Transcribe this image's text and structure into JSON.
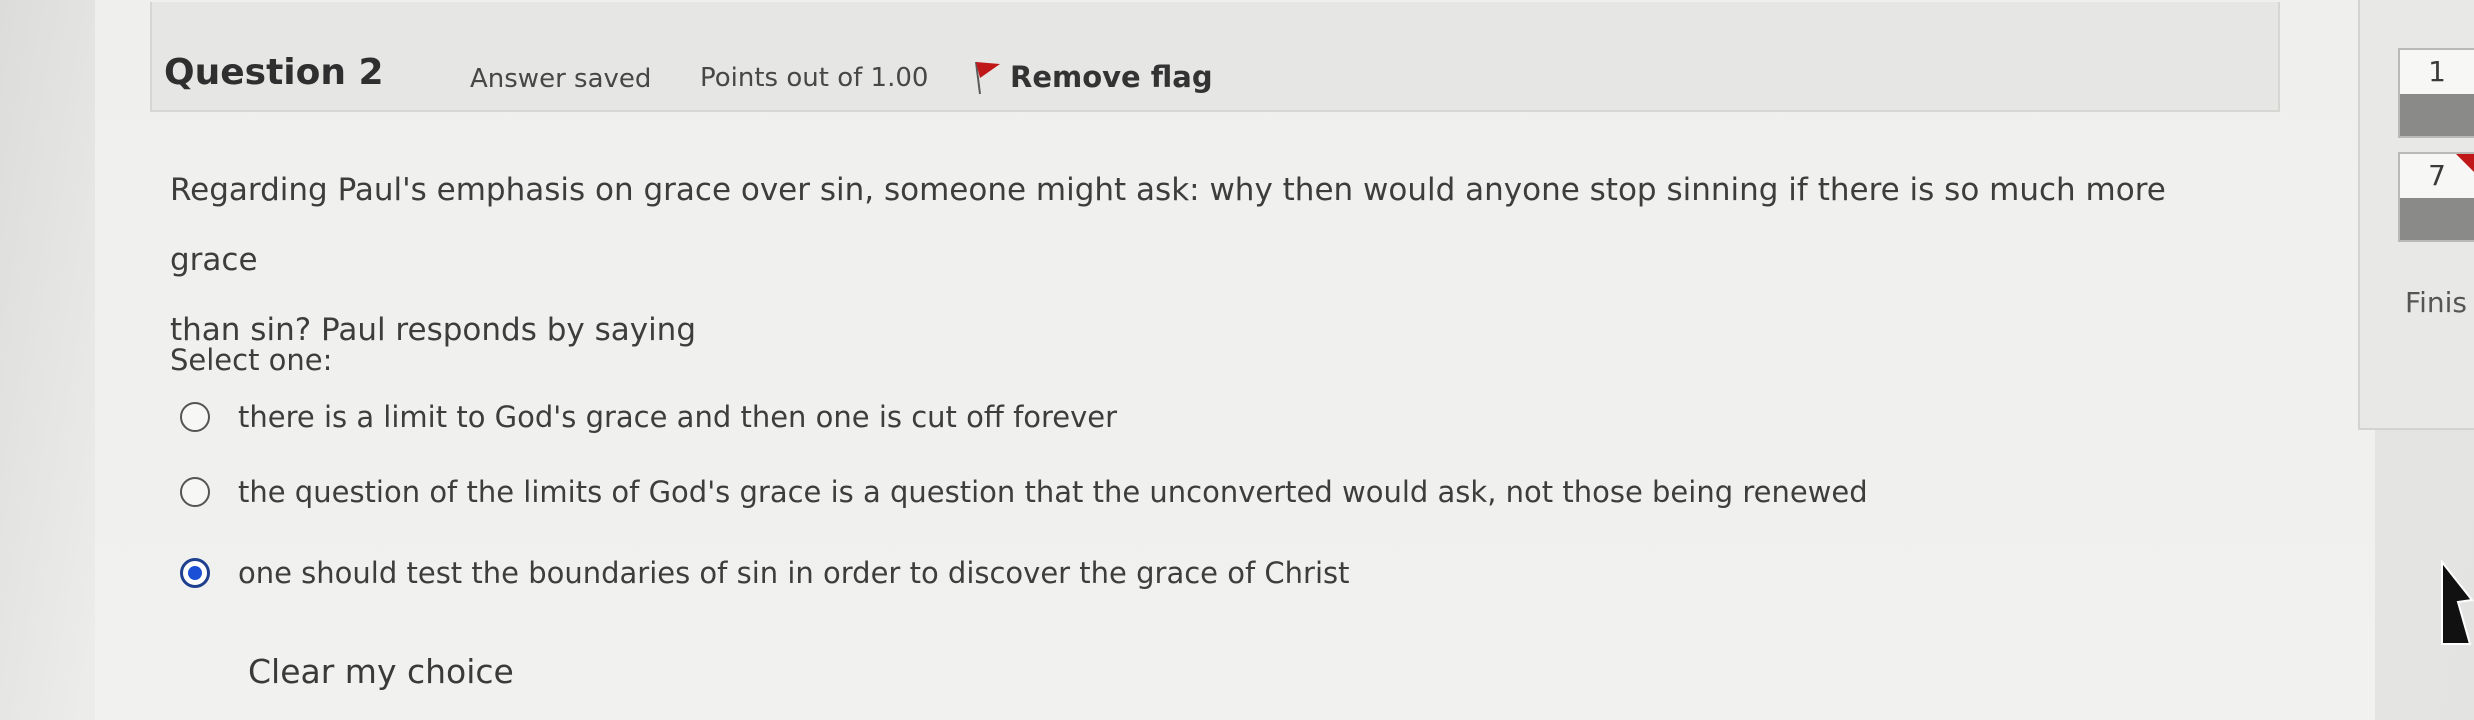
{
  "question": {
    "number_label": "Question 2",
    "state": "Answer saved",
    "grade": "Points out of 1.00",
    "flag_label": "Remove flag",
    "text_line1": "Regarding Paul's emphasis on grace over sin, someone might ask: why then would anyone stop sinning if there is so much more grace",
    "text_line2": "than sin? Paul responds by saying",
    "prompt": "Select one:",
    "options": [
      {
        "label": "there is a limit to God's grace and then one is cut off forever",
        "selected": false
      },
      {
        "label": "the question of the limits of God's grace is a question that the unconverted would ask, not those being renewed",
        "selected": false
      },
      {
        "label": "one should test the boundaries of sin in order to discover the grace of Christ",
        "selected": true
      }
    ],
    "clear_label": "Clear my choice"
  },
  "navigation": {
    "buttons": [
      {
        "label": "1",
        "flagged": false
      },
      {
        "label": "7",
        "flagged": true
      }
    ],
    "finish_label": "Finis"
  },
  "colors": {
    "flag": "#c01818",
    "radio_selected": "#1b4fd6",
    "answered_fill": "#8a8a88"
  }
}
